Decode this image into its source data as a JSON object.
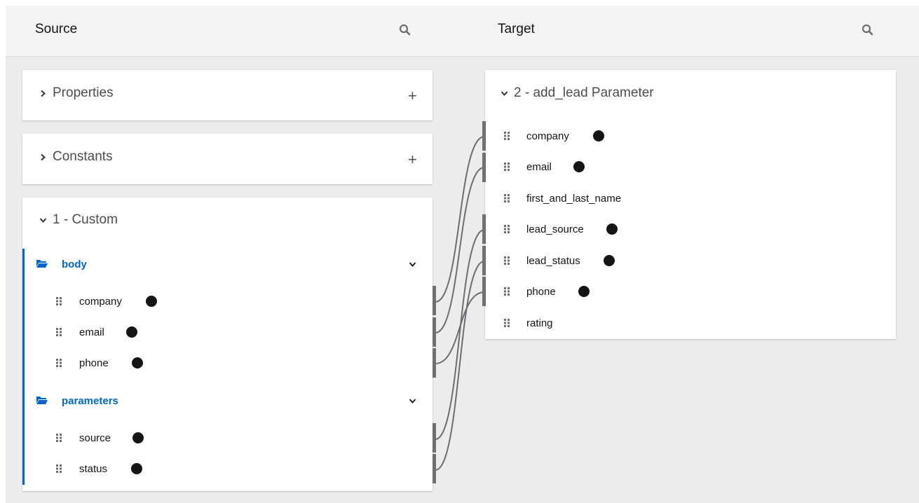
{
  "source": {
    "title": "Source"
  },
  "target": {
    "title": "Target"
  },
  "source_panels": {
    "properties": {
      "label": "Properties"
    },
    "constants": {
      "label": "Constants"
    },
    "custom": {
      "label": "1 - Custom",
      "folders": [
        {
          "label": "body",
          "fields": [
            "company",
            "email",
            "phone"
          ]
        },
        {
          "label": "parameters",
          "fields": [
            "source",
            "status"
          ]
        }
      ]
    }
  },
  "target_panel": {
    "label": "2 - add_lead Parameter",
    "fields": [
      "company",
      "email",
      "first_and_last_name",
      "lead_source",
      "lead_status",
      "phone",
      "rating"
    ]
  },
  "icons": {
    "search": "search-icon",
    "expand": "chevron-right-icon",
    "collapse": "chevron-down-icon",
    "add": "plus-icon",
    "folder": "folder-open-icon",
    "drag": "grip-icon",
    "mapped": "mapped-dot-icon"
  },
  "colors": {
    "accent": "#0066cc",
    "line": "#6a6e73"
  },
  "mappings": [
    {
      "from": "body.company",
      "to": "company"
    },
    {
      "from": "body.email",
      "to": "email"
    },
    {
      "from": "body.phone",
      "to": "phone"
    },
    {
      "from": "parameters.source",
      "to": "lead_source"
    },
    {
      "from": "parameters.status",
      "to": "lead_status"
    }
  ]
}
